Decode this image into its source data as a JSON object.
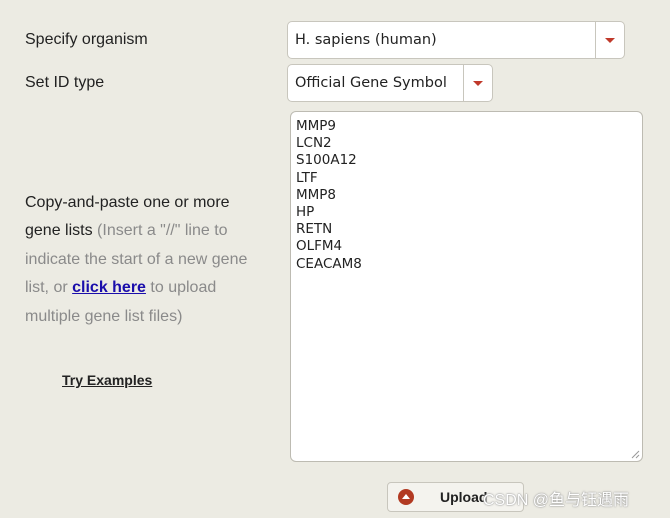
{
  "organism": {
    "label": "Specify organism",
    "value": "H. sapiens (human)"
  },
  "id_type": {
    "label": "Set ID type",
    "value": "Official Gene Symbol"
  },
  "instructions": {
    "part1": "Copy-and-paste one or more gene lists",
    "part2": " (Insert a \"//\" line to indicate the start of a new gene list, or ",
    "link": "click here",
    "part3": " to upload multiple gene list files)"
  },
  "try_examples": "Try Examples",
  "gene_list": [
    "MMP9",
    "LCN2",
    "S100A12",
    "LTF",
    "MMP8",
    "HP",
    "RETN",
    "OLFM4",
    "CEACAM8"
  ],
  "upload_label": "Upload",
  "watermark": "CSDN @鱼与钰遇雨",
  "colors": {
    "background": "#ecebe3",
    "accent": "#c0392b",
    "link": "#1a0dab"
  }
}
